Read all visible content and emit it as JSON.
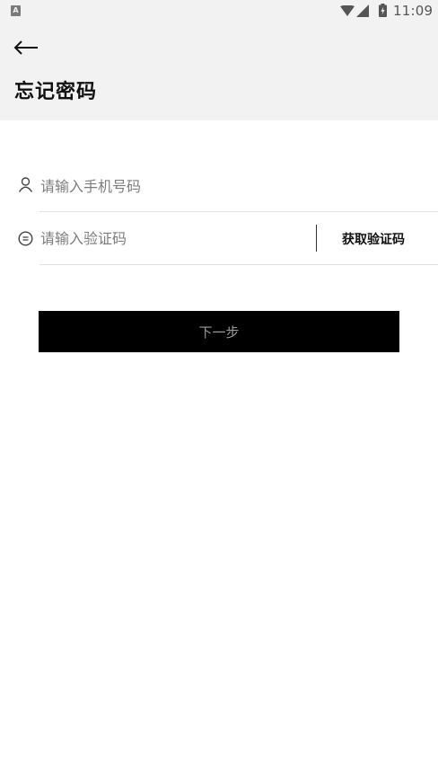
{
  "status_bar": {
    "notification_icon": "a-notification-icon",
    "notification_glyph": "A",
    "wifi_icon": "wifi-icon",
    "signal_icon": "cellular-signal-icon",
    "battery_icon": "battery-charging-icon",
    "time": "11:09"
  },
  "header": {
    "back_icon": "arrow-left-icon",
    "title": "忘记密码",
    "background": "#f2f2f2"
  },
  "form": {
    "phone": {
      "icon": "user-icon",
      "value": "",
      "placeholder": "请输入手机号码"
    },
    "code": {
      "icon": "message-icon",
      "value": "",
      "placeholder": "请输入验证码",
      "get_code_label": "获取验证码"
    },
    "next_label": "下一步"
  },
  "colors": {
    "button_background": "#000000",
    "button_text": "#9a9a9a",
    "placeholder": "#7d7d7d",
    "divider": "#e3e3e3"
  }
}
